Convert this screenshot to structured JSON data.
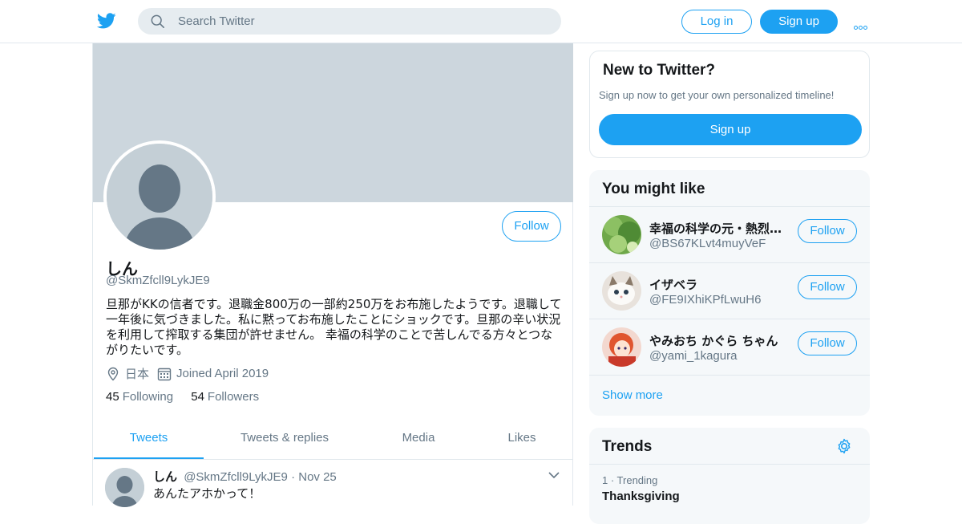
{
  "header": {
    "search_placeholder": "Search Twitter",
    "login_label": "Log in",
    "signup_label": "Sign up"
  },
  "profile": {
    "name": "しん",
    "handle": "@SkmZfcll9LykJE9",
    "bio": "旦那がKKの信者です。退職金800万の一部約250万をお布施したようです。退職して一年後に気づきました。私に黙ってお布施したことにショックです。旦那の辛い状況を利用して搾取する集団が許せません。 幸福の科学のことで苦しんでる方々とつながりたいです。",
    "location": "日本",
    "joined": "Joined April 2019",
    "following_count": "45",
    "following_label": "Following",
    "followers_count": "54",
    "followers_label": "Followers",
    "follow_label": "Follow"
  },
  "tabs": [
    {
      "label": "Tweets",
      "active": true
    },
    {
      "label": "Tweets & replies",
      "active": false
    },
    {
      "label": "Media",
      "active": false
    },
    {
      "label": "Likes",
      "active": false
    }
  ],
  "tweet": {
    "name": "しん",
    "handle": "@SkmZfcll9LykJE9",
    "separator": "·",
    "date": "Nov 25",
    "text": "あんたアホかって！"
  },
  "new_to_twitter": {
    "title": "New to Twitter?",
    "subtitle": "Sign up now to get your own personalized timeline!",
    "signup_label": "Sign up"
  },
  "you_might_like": {
    "title": "You might like",
    "items": [
      {
        "name": "幸福の科学の元・熱烈信者",
        "handle": "@BS67KLvt4muyVeF",
        "follow_label": "Follow"
      },
      {
        "name": "イザベラ",
        "handle": "@FE9IXhiKPfLwuH6",
        "follow_label": "Follow"
      },
      {
        "name": "やみおち かぐら ちゃん",
        "handle": "@yami_1kagura",
        "follow_label": "Follow"
      }
    ],
    "show_more": "Show more"
  },
  "trends": {
    "title": "Trends",
    "items": [
      {
        "meta": "1 · Trending",
        "name": "Thanksgiving"
      }
    ]
  },
  "colors": {
    "accent": "#1da1f2",
    "banner": "#ccd6dd",
    "muted": "#657786"
  }
}
